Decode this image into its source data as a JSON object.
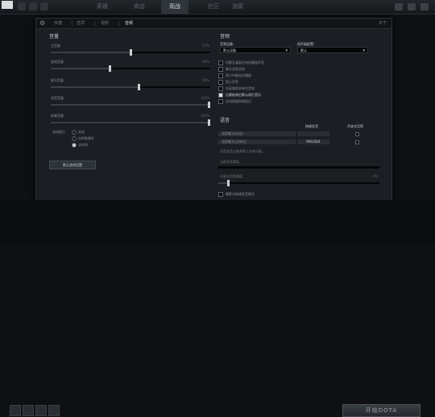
{
  "topbar": {
    "logo": "",
    "nav": [
      "英雄",
      "商店",
      "观战",
      "社区",
      "游廊"
    ],
    "active_nav": "观战"
  },
  "subnav": {
    "tabs": [
      "快捷",
      "选项",
      "视频",
      "音频"
    ],
    "active": "音频",
    "close": "关于"
  },
  "audio": {
    "title": "音量",
    "sliders": [
      {
        "label": "主音量",
        "value": 51,
        "display": "51%"
      },
      {
        "label": "游戏音量",
        "value": 38,
        "display": "38%"
      },
      {
        "label": "配乐音量",
        "value": 56,
        "display": "56%"
      },
      {
        "label": "语音音量",
        "value": 100,
        "display": "100%"
      },
      {
        "label": "前景音量",
        "value": 100,
        "display": "100%"
      }
    ],
    "music_label": "游戏配乐",
    "radios": [
      {
        "label": "关闭",
        "selected": false
      },
      {
        "label": "仅特殊事件",
        "selected": false
      },
      {
        "label": "全时间",
        "selected": true
      }
    ],
    "reset_button": "默认游戏设置"
  },
  "device": {
    "title": "音频",
    "output_label": "音频设备:",
    "output_value": "默认设备",
    "speaker_label": "扬声器配置:",
    "speaker_value": "默认",
    "checks": [
      {
        "label": "切换至桌面后持续播放声音",
        "on": false
      },
      {
        "label": "聊天消息音效",
        "on": false
      },
      {
        "label": "简介中解说员播报",
        "on": false
      },
      {
        "label": "提示声音",
        "on": false
      },
      {
        "label": "仅英雄相关单位音效",
        "on": false
      },
      {
        "label": "比赛结束后默认再打音乐",
        "on": true
      },
      {
        "label": "自动根据网络延迟",
        "on": false
      }
    ]
  },
  "voice": {
    "title": "语音",
    "col_hotkey": "按键发音",
    "col_open": "开放式话筒",
    "rows": [
      {
        "label": "语音聊天(队伍)",
        "key": "",
        "open": false
      },
      {
        "label": "语音聊天(全体队)",
        "key": "MOUSE4",
        "open": false
      }
    ],
    "hint": "语音录音设备将默认系统设备。",
    "threshold_label": "当前录音阈值",
    "open_label": "开放式话筒阈值",
    "open_value": 6,
    "open_display": "6%",
    "mute_label": "静默式按键发音模式",
    "mute_on": false
  },
  "bottom": {
    "play_label": "开始DOTA"
  }
}
